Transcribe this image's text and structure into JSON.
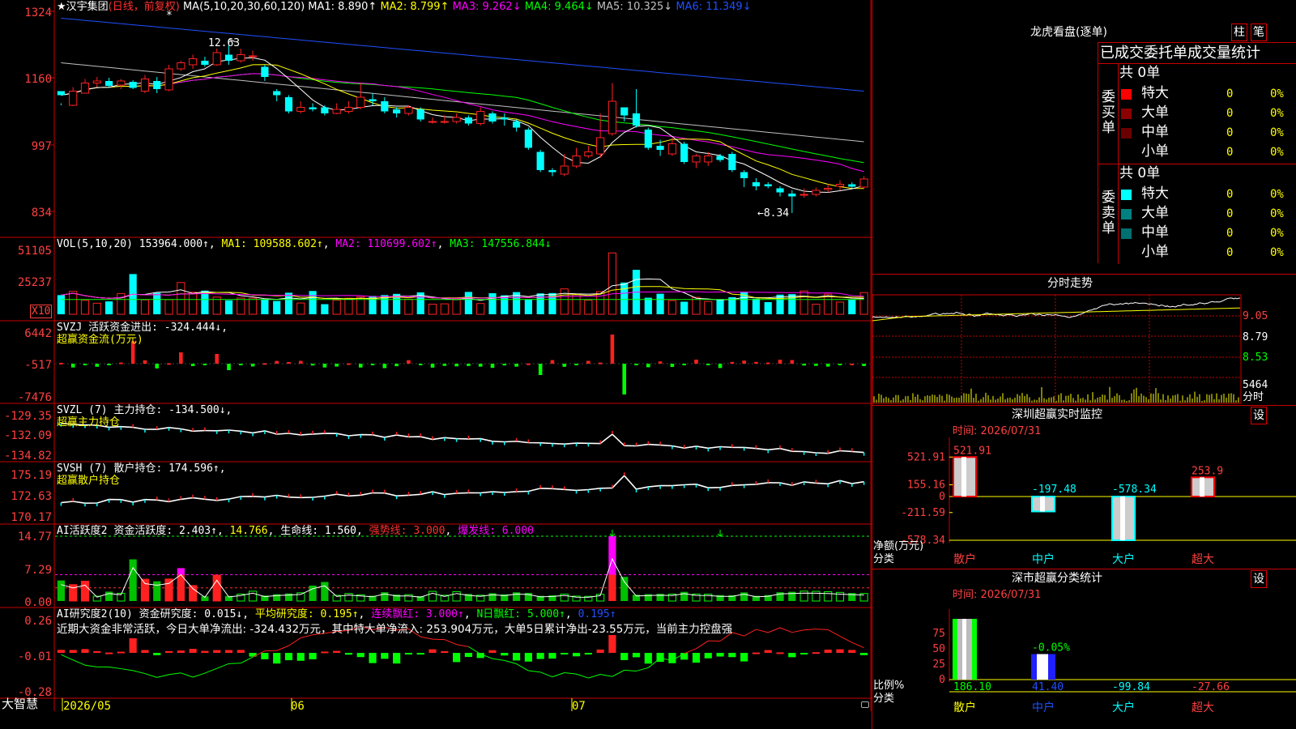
{
  "header": {
    "star": "★",
    "stock_name": "汉宇集团",
    "period_label": "(日线，前复权)",
    "ma_name": "MA(5,10,20,30,60,120)",
    "ma1": "MA1: 8.890↑",
    "ma2": "MA2: 8.799↑",
    "ma3": "MA3: 9.262↓",
    "ma4": "MA4: 9.464↓",
    "ma5": "MA5: 10.325↓",
    "ma6": "MA6: 11.349↓"
  },
  "main_chart": {
    "y_ticks": [
      "1324",
      "1160",
      "997",
      "834"
    ],
    "high_label": "12.63",
    "low_label": "←8.34",
    "marker": "*"
  },
  "vol": {
    "title": "VOL(5,10,20)",
    "value": "153964.000↑",
    "ma1": "MA1: 109588.602↑",
    "ma2": "MA2: 110699.602↑",
    "ma3": "MA3: 147556.844↓",
    "y_ticks": [
      "51105",
      "25237"
    ],
    "unit": "X10"
  },
  "svzj": {
    "title": "SVZJ",
    "value": "活跃资金进出: -324.444↓",
    "sub": "超赢资金流(万元)",
    "y_ticks": [
      "6442",
      "-517",
      "-7476"
    ]
  },
  "svzl": {
    "title": "SVZL (7)",
    "value": "主力持仓: -134.500↓",
    "sub": "超赢主力持仓",
    "y_ticks": [
      "-129.35",
      "-132.09",
      "-134.82"
    ]
  },
  "svsh": {
    "title": "SVSH (7)",
    "value": "散户持仓: 174.596↑",
    "sub": "超赢散户持仓",
    "y_ticks": [
      "175.19",
      "172.63",
      "170.17"
    ]
  },
  "ai_act": {
    "title": "AI活跃度2",
    "value1": "资金活跃度: 2.403↑",
    "value2": "14.766",
    "value3": "生命线: 1.560",
    "value4": "强势线: 3.000",
    "value5": "爆发线: 6.000",
    "y_ticks": [
      "14.77",
      "7.29",
      "0.00"
    ]
  },
  "ai_res": {
    "title": "AI研究度2(10)",
    "value1": "资金研究度: 0.015↓",
    "value2": "平均研究度: 0.195↑",
    "value3": "连续飘红: 3.000↑",
    "value4": "N日飘红: 5.000↑",
    "value5": "0.195↑",
    "comment": "近期大资金非常活跃，今日大单净流出: -324.432万元，其中特大单净流入: 253.904万元，大单5日累计净出-23.55万元，当前主力控盘强",
    "y_ticks": [
      "0.26",
      "-0.01",
      "-0.28"
    ]
  },
  "bottom": {
    "brand": "大智慧",
    "dates": [
      "2026/05",
      "06",
      "07"
    ]
  },
  "panel_lhb": {
    "title": "龙虎看盘(逐单)",
    "btn_bar": "柱",
    "btn_pen": "笔",
    "stat_title": "已成交委托单成交量统计",
    "buy": {
      "side_label": "委买单",
      "total": "共 0单",
      "rows": [
        {
          "label": "特大",
          "count": "0",
          "pct": "0%"
        },
        {
          "label": "大单",
          "count": "0",
          "pct": "0%"
        },
        {
          "label": "中单",
          "count": "0",
          "pct": "0%"
        },
        {
          "label": "小单",
          "count": "0",
          "pct": "0%"
        }
      ]
    },
    "sell": {
      "side_label": "委卖单",
      "total": "共 0单",
      "rows": [
        {
          "label": "特大",
          "count": "0",
          "pct": "0%"
        },
        {
          "label": "大单",
          "count": "0",
          "pct": "0%"
        },
        {
          "label": "中单",
          "count": "0",
          "pct": "0%"
        },
        {
          "label": "小单",
          "count": "0",
          "pct": "0%"
        }
      ]
    }
  },
  "panel_timeshare": {
    "title": "分时走势",
    "y_ticks": [
      "9.05",
      "8.79",
      "8.53"
    ],
    "vol_tick": "5464",
    "vol_label": "分时"
  },
  "panel_sz_monitor": {
    "title": "深圳超赢实时监控",
    "settings": "设",
    "time_label": "时间: 2026/07/31",
    "y_ticks": [
      "521.91",
      "155.16",
      "0",
      "-211.59",
      "-578.34"
    ],
    "axis_label1": "净额(万元)",
    "axis_label2": "分类",
    "categories": [
      "散户",
      "中户",
      "大户",
      "超大"
    ],
    "values": [
      521.91,
      -197.48,
      -578.34,
      253.9
    ],
    "value_labels": [
      "521.91",
      "-197.48",
      "-578.34",
      "253.9"
    ]
  },
  "panel_sz_classify": {
    "title": "深市超赢分类统计",
    "settings": "设",
    "time_label": "时间: 2026/07/31",
    "y_ticks": [
      "75",
      "50",
      "25",
      "0"
    ],
    "axis_label1": "比例%",
    "axis_label2": "分类",
    "categories": [
      "散户",
      "中户",
      "大户",
      "超大"
    ],
    "ratio_values": [
      100,
      42
    ],
    "mid_label": "-0.05%",
    "amounts": [
      "186.10",
      "41.40",
      "-99.84",
      "-27.66"
    ]
  },
  "colors": {
    "up": "#ff2020",
    "down": "#00ffff",
    "grid": "#c80000",
    "ma5": "#ffffff",
    "ma10": "#ffff00",
    "ma20": "#ff00ff",
    "ma30": "#00ff00",
    "ma60": "#c0c0c0",
    "ma120": "#2050ff"
  },
  "chart_data": {
    "type": "candlestick",
    "series": [
      {
        "name": "汉宇集团",
        "ohlc": [
          [
            11.35,
            11.25,
            11.05,
            11.0
          ],
          [
            11.0,
            11.35,
            11.45,
            10.98
          ],
          [
            11.3,
            11.55,
            11.65,
            11.3
          ],
          [
            11.55,
            11.6,
            11.7,
            11.45
          ],
          [
            11.6,
            11.48,
            11.68,
            11.44
          ],
          [
            11.5,
            11.6,
            11.65,
            11.4
          ],
          [
            11.58,
            11.43,
            11.62,
            11.4
          ],
          [
            11.35,
            11.65,
            11.75,
            11.3
          ],
          [
            11.6,
            11.4,
            11.7,
            11.3
          ],
          [
            11.38,
            11.9,
            12.0,
            11.35
          ],
          [
            11.9,
            12.05,
            12.1,
            11.85
          ],
          [
            12.0,
            12.15,
            12.25,
            11.9
          ],
          [
            12.1,
            12.0,
            12.2,
            11.95
          ],
          [
            12.0,
            12.3,
            12.4,
            11.98
          ],
          [
            12.25,
            12.1,
            12.63,
            12.0
          ],
          [
            12.1,
            12.25,
            12.4,
            12.05
          ],
          [
            12.2,
            12.22,
            12.35,
            12.1
          ],
          [
            11.95,
            11.7,
            12.0,
            11.6
          ],
          [
            11.35,
            11.25,
            11.4,
            11.1
          ],
          [
            11.2,
            10.85,
            11.25,
            10.8
          ],
          [
            10.85,
            10.95,
            11.1,
            10.8
          ],
          [
            10.95,
            10.9,
            11.05,
            10.85
          ],
          [
            10.95,
            10.8,
            11.0,
            10.75
          ],
          [
            10.8,
            10.9,
            11.05,
            10.78
          ],
          [
            10.85,
            10.95,
            11.1,
            10.8
          ],
          [
            10.95,
            11.2,
            11.55,
            10.9
          ],
          [
            11.15,
            11.1,
            11.3,
            11.0
          ],
          [
            11.1,
            10.85,
            11.2,
            10.8
          ],
          [
            10.9,
            10.8,
            10.95,
            10.7
          ],
          [
            10.8,
            10.95,
            11.0,
            10.75
          ],
          [
            10.9,
            10.65,
            10.95,
            10.6
          ],
          [
            10.6,
            10.6,
            10.7,
            10.55
          ],
          [
            10.6,
            10.6,
            10.75,
            10.55
          ],
          [
            10.6,
            10.7,
            10.8,
            10.55
          ],
          [
            10.7,
            10.55,
            10.75,
            10.5
          ],
          [
            10.55,
            10.85,
            10.95,
            10.5
          ],
          [
            10.8,
            10.6,
            10.85,
            10.55
          ],
          [
            10.7,
            10.65,
            10.8,
            10.5
          ],
          [
            10.6,
            10.45,
            10.65,
            10.35
          ],
          [
            10.4,
            9.95,
            10.45,
            9.9
          ],
          [
            9.85,
            9.4,
            9.9,
            9.35
          ],
          [
            9.4,
            9.35,
            9.45,
            9.25
          ],
          [
            9.3,
            9.5,
            9.8,
            9.25
          ],
          [
            9.5,
            9.75,
            9.95,
            9.45
          ],
          [
            9.75,
            9.85,
            10.0,
            9.7
          ],
          [
            9.8,
            10.2,
            10.8,
            9.7
          ],
          [
            10.3,
            11.1,
            11.55,
            10.25
          ],
          [
            10.95,
            10.75,
            10.95,
            10.6
          ],
          [
            10.8,
            10.5,
            11.4,
            10.45
          ],
          [
            10.4,
            9.95,
            10.45,
            9.9
          ],
          [
            10.0,
            9.9,
            10.15,
            9.75
          ],
          [
            9.8,
            10.05,
            10.2,
            9.75
          ],
          [
            10.05,
            9.6,
            10.1,
            9.55
          ],
          [
            9.6,
            9.75,
            9.8,
            9.45
          ],
          [
            9.6,
            9.75,
            9.85,
            9.5
          ],
          [
            9.75,
            9.65,
            9.8,
            9.6
          ],
          [
            9.8,
            9.4,
            9.85,
            9.35
          ],
          [
            9.35,
            9.2,
            9.4,
            8.98
          ],
          [
            9.1,
            9.0,
            9.2,
            8.9
          ],
          [
            9.05,
            9.0,
            9.1,
            8.95
          ],
          [
            8.95,
            8.85,
            9.0,
            8.75
          ],
          [
            8.82,
            8.75,
            8.9,
            8.34
          ],
          [
            8.8,
            8.8,
            8.95,
            8.72
          ],
          [
            8.8,
            8.9,
            8.97,
            8.75
          ],
          [
            8.92,
            8.95,
            9.05,
            8.85
          ],
          [
            9.0,
            9.05,
            9.15,
            8.9
          ],
          [
            9.05,
            8.99,
            9.1,
            8.95
          ],
          [
            8.98,
            9.18,
            9.25,
            8.95
          ]
        ]
      }
    ],
    "x_labels": [
      "2026/05",
      "06",
      "07"
    ],
    "y_ticks": [
      "1324",
      "1160",
      "997",
      "834"
    ],
    "high": 12.63,
    "low": 8.34
  }
}
